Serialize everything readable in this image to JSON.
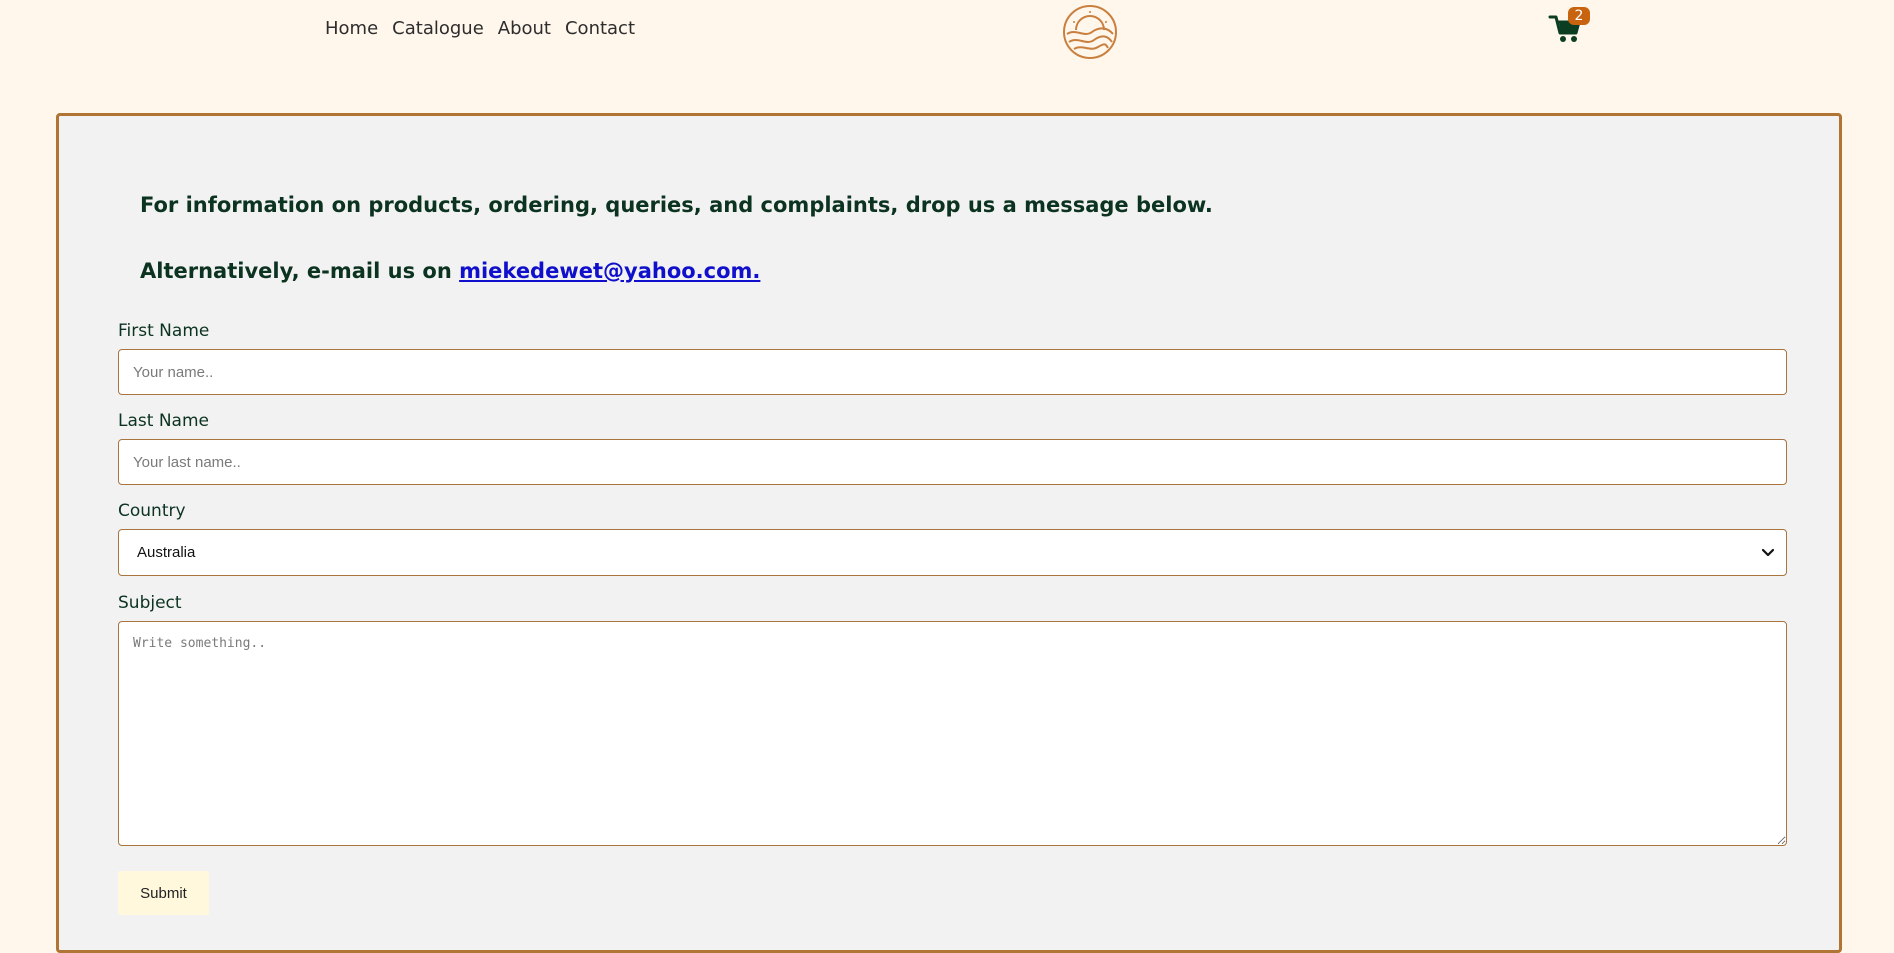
{
  "nav": {
    "items": [
      {
        "label": "Home"
      },
      {
        "label": "Catalogue"
      },
      {
        "label": "About"
      },
      {
        "label": "Contact"
      }
    ]
  },
  "logo": {
    "icon": "sun-over-hills-logo"
  },
  "cart": {
    "icon": "shopping-cart-icon",
    "count": "2"
  },
  "contact": {
    "intro_line1": "For information on products, ordering, queries, and complaints, drop us a message below.",
    "intro_line2_prefix": "Alternatively, e-mail us on ",
    "email_link": "miekedewet@yahoo.com."
  },
  "form": {
    "first_name": {
      "label": "First Name",
      "placeholder": "Your name..",
      "value": ""
    },
    "last_name": {
      "label": "Last Name",
      "placeholder": "Your last name..",
      "value": ""
    },
    "country": {
      "label": "Country",
      "selected": "Australia"
    },
    "subject": {
      "label": "Subject",
      "placeholder": "Write something..",
      "value": ""
    },
    "submit_label": "Submit"
  },
  "colors": {
    "page_background": "#fff6ec",
    "card_background": "#f2f2f2",
    "accent_border": "#b07434",
    "text_dark_green": "#0b3320",
    "link_blue": "#1010cc",
    "badge_orange": "#c8640f",
    "submit_background": "#fff8dc"
  }
}
